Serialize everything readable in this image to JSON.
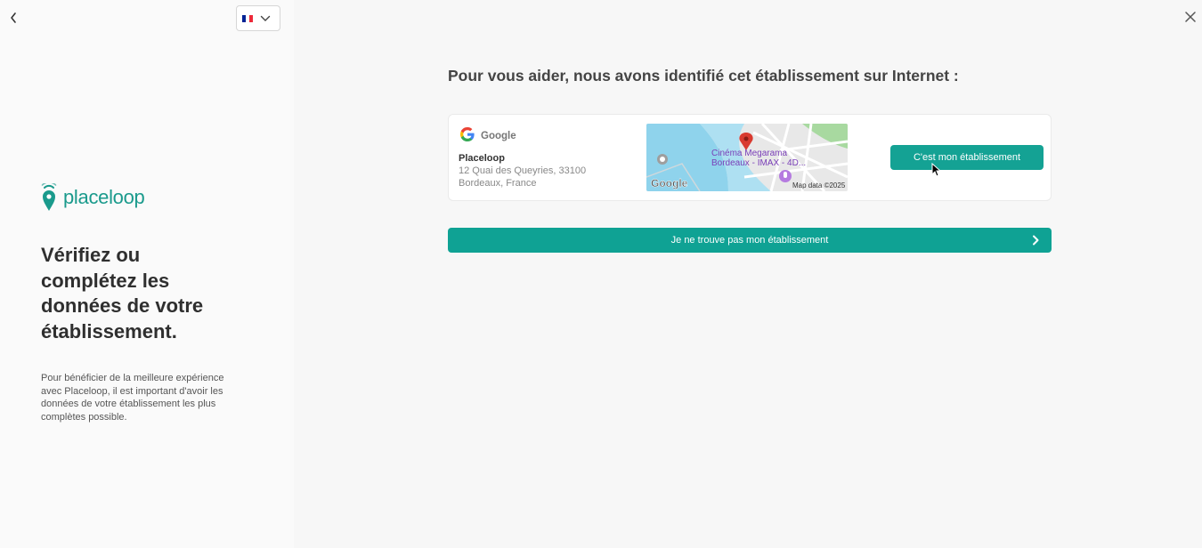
{
  "header": {
    "back_icon": "chevron-left-icon",
    "language": {
      "flag": "fr",
      "flag_colors": [
        "#002395",
        "#ffffff",
        "#ed2939"
      ],
      "dropdown_icon": "chevron-down-icon"
    },
    "close_icon": "close-icon"
  },
  "sidebar": {
    "logo_text": "placeloop",
    "title": "Vérifiez ou complétez les données de votre établissement.",
    "description": "Pour bénéficier de la meilleure expérience avec Placeloop, il est important d'avoir les données de votre établissement les plus complètes possible."
  },
  "main": {
    "heading": "Pour vous aider, nous avons identifié cet établissement sur Internet :",
    "result": {
      "source": "Google",
      "name": "Placeloop",
      "address_line1": "12 Quai des Queyries, 33100",
      "address_line2": "Bordeaux, France",
      "map": {
        "place_label_line1": "Cinéma Megarama",
        "place_label_line2": "Bordeaux - IMAX - 4D...",
        "google_label": "Google",
        "attribution": "Map data ©2025"
      },
      "select_label": "C'est mon établissement"
    },
    "not_found_label": "Je ne trouve pas mon établissement"
  },
  "colors": {
    "accent": "#14a294",
    "heading": "#444444",
    "map_water": "#8fd3ec"
  }
}
